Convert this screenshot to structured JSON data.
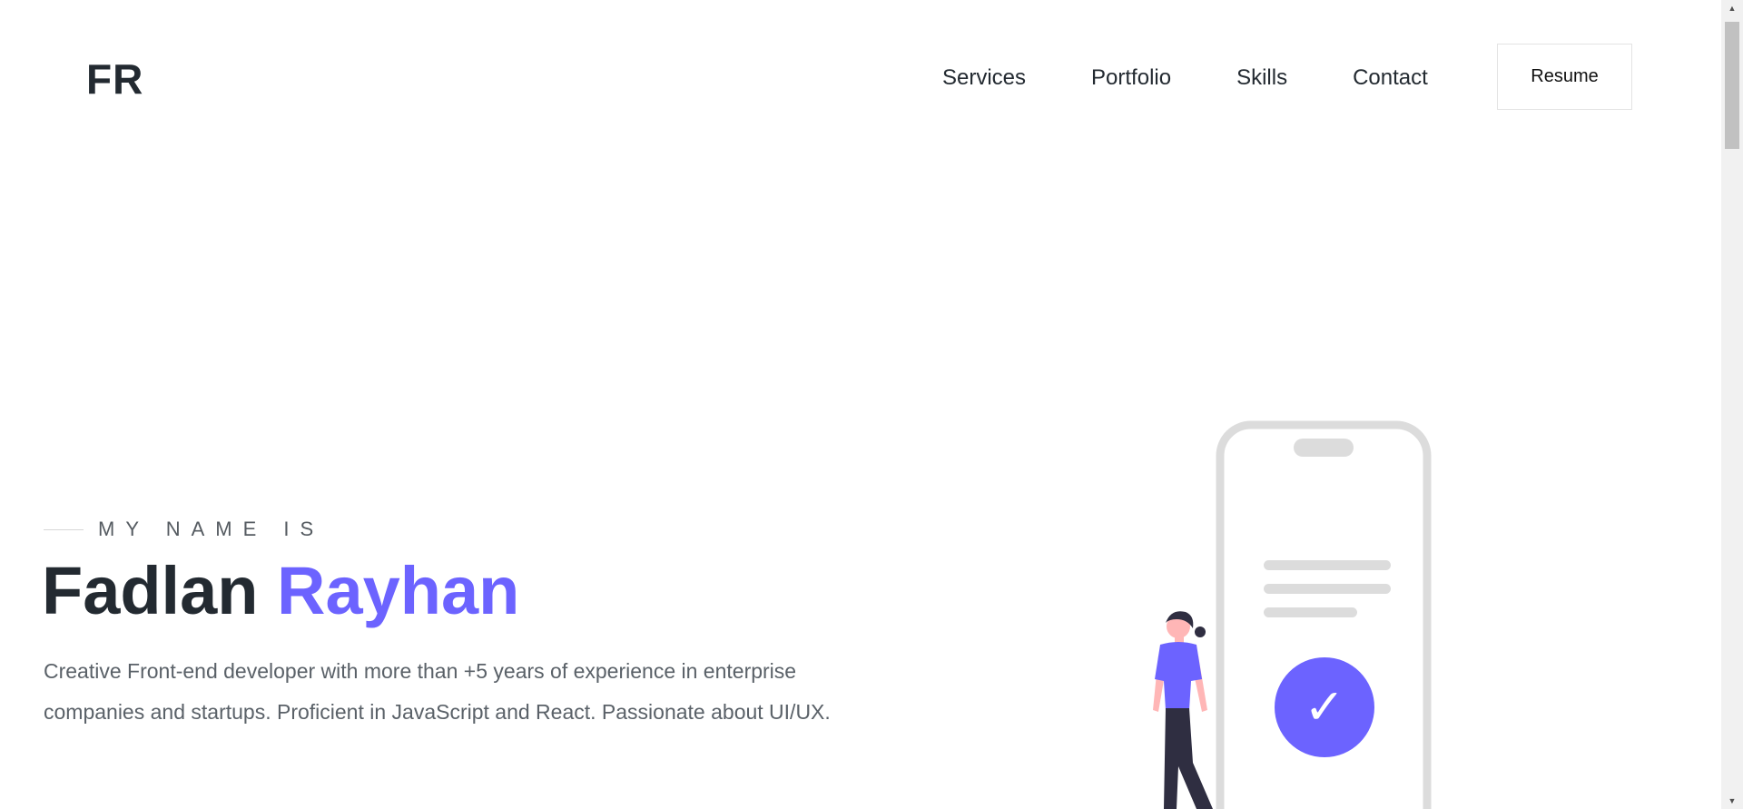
{
  "header": {
    "logo": "FR",
    "nav": [
      {
        "label": "Services"
      },
      {
        "label": "Portfolio"
      },
      {
        "label": "Skills"
      },
      {
        "label": "Contact"
      }
    ],
    "resume_label": "Resume"
  },
  "hero": {
    "eyebrow": "MY NAME IS",
    "first_name": "Fadlan",
    "last_name": "Rayhan",
    "description": "Creative Front-end developer with more than +5 years of experience in enterprise companies and startups. Proficient in JavaScript and React. Passionate about UI/UX."
  },
  "illustration": {
    "check_glyph": "✓",
    "icons": [
      "phone-icon",
      "person-icon",
      "checkmark-icon"
    ]
  },
  "scrollbar": {
    "up_glyph": "▲",
    "down_glyph": "▼"
  },
  "colors": {
    "accent": "#6c63ff",
    "text_dark": "#232a31",
    "text_muted": "#5a6168",
    "phone_gray": "#dcdcdc",
    "person_pants": "#2f2e41",
    "skin": "#ffb6b6"
  }
}
